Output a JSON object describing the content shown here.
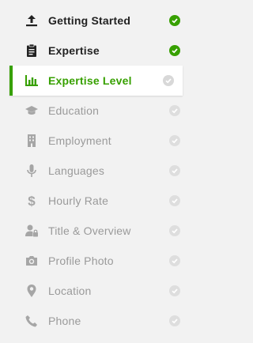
{
  "colors": {
    "accent": "#37a000",
    "muted_text": "#9a9a9a",
    "muted_check": "#dedede",
    "background": "#f2f2f2"
  },
  "steps": [
    {
      "label": "Getting Started",
      "icon": "upload-icon",
      "status": "done"
    },
    {
      "label": "Expertise",
      "icon": "clipboard-icon",
      "status": "done"
    },
    {
      "label": "Expertise Level",
      "icon": "bar-chart-icon",
      "status": "active"
    },
    {
      "label": "Education",
      "icon": "graduation-cap-icon",
      "status": "todo"
    },
    {
      "label": "Employment",
      "icon": "building-icon",
      "status": "todo"
    },
    {
      "label": "Languages",
      "icon": "microphone-icon",
      "status": "todo"
    },
    {
      "label": "Hourly Rate",
      "icon": "dollar-icon",
      "status": "todo"
    },
    {
      "label": "Title & Overview",
      "icon": "user-lock-icon",
      "status": "todo"
    },
    {
      "label": "Profile Photo",
      "icon": "camera-icon",
      "status": "todo"
    },
    {
      "label": "Location",
      "icon": "map-pin-icon",
      "status": "todo"
    },
    {
      "label": "Phone",
      "icon": "phone-icon",
      "status": "todo"
    }
  ]
}
